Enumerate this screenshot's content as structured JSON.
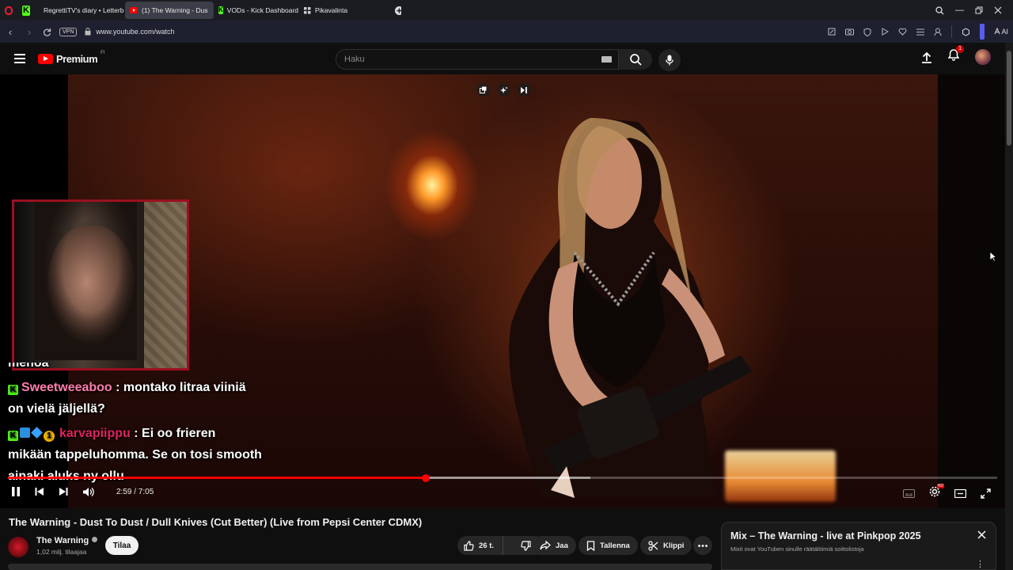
{
  "browser": {
    "tabs": [
      {
        "label": "",
        "icon": "opera-icon"
      },
      {
        "label": "",
        "icon": "kick-icon"
      },
      {
        "label": "RegrettiTV's diary • Letterb",
        "icon": "letterboxd-icon"
      },
      {
        "label": "(1) The Warning - Dus",
        "icon": "youtube-icon",
        "active": true
      },
      {
        "label": "VODs - Kick Dashboard",
        "icon": "kick-icon"
      },
      {
        "label": "Pikavalinta",
        "icon": "grid-icon"
      }
    ],
    "vpn_label": "VPN",
    "url": "www.youtube.com/watch",
    "ai_label": "AI"
  },
  "header": {
    "logo_text": "Premium",
    "logo_region": "FI",
    "search_placeholder": "Haku",
    "notification_count": "1"
  },
  "video": {
    "current_time": "2:59",
    "duration": "7:05",
    "time_display": "2:59 / 7:05",
    "progress_percent": 42.2,
    "loaded_percent": 58.9,
    "settings_badge": "HD"
  },
  "chat": {
    "partial_top": "menoa",
    "messages": [
      {
        "user": "Sweetweeaboo",
        "text_line1": " : montako litraa viiniä",
        "text_line2": "on vielä jäljellä?"
      },
      {
        "user": "karvapiippu",
        "text_line1": " : Ei oo frieren",
        "text_line2": "mikään tappeluhomma. Se on tosi smooth",
        "text_line3": "ainaki aluks ny ollu"
      }
    ]
  },
  "watch": {
    "title": "The Warning - Dust To Dust / Dull Knives (Cut Better) (Live from Pepsi Center CDMX)",
    "channel_name": "The Warning",
    "subscribers": "1,02 milj. tilaajaa",
    "subscribe_label": "Tilaa",
    "likes": "26 t.",
    "share_label": "Jaa",
    "save_label": "Tallenna",
    "clip_label": "Klippi"
  },
  "mix": {
    "title": "Mix – The Warning - live at Pinkpop 2025",
    "subtitle": "Mixit ovat YouTuben sinulle räätälöimiä soittolistoja"
  },
  "colors": {
    "youtube_red": "#ff0000",
    "kick_green": "#53fc18",
    "chat_user_pink": "#ff7eb0",
    "chat_user_red": "#e0245e"
  }
}
